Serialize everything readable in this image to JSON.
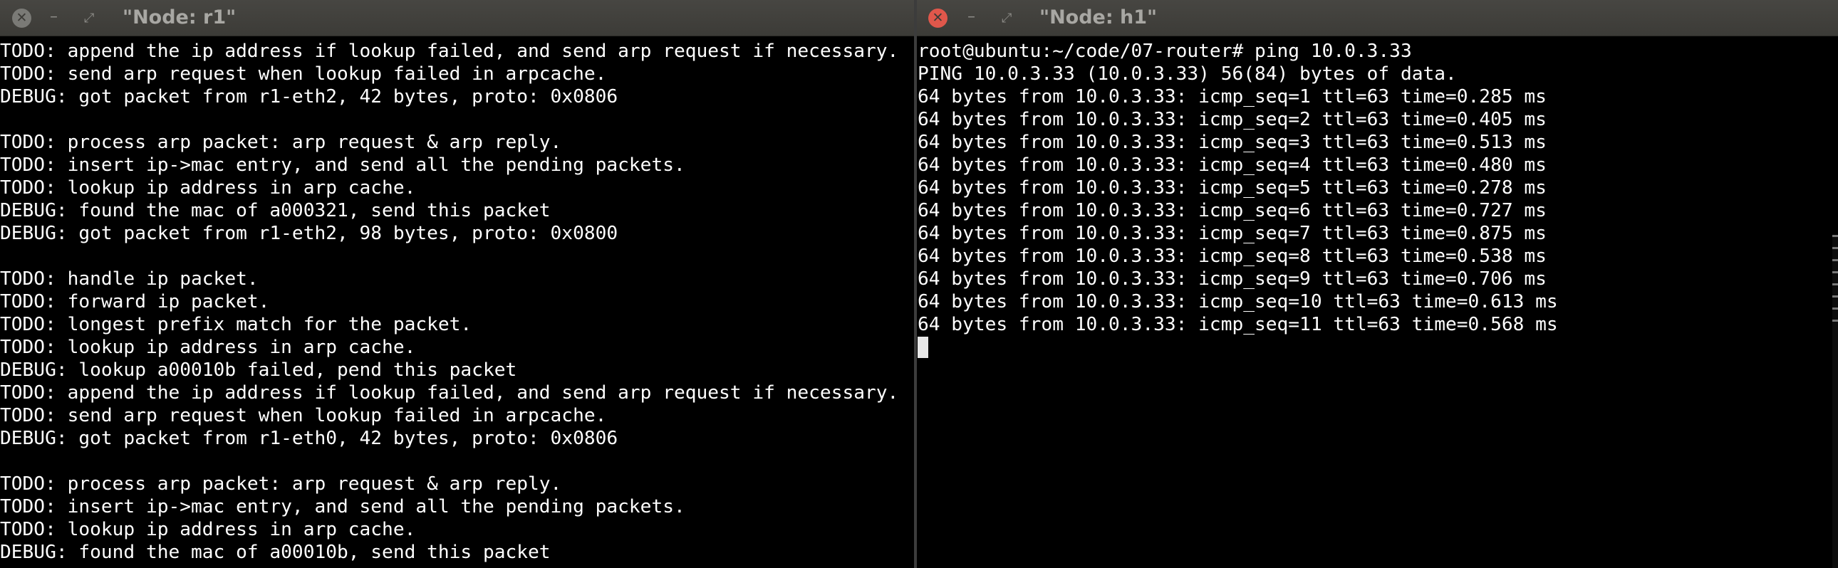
{
  "windows": {
    "r1": {
      "title": "\"Node: r1\"",
      "lines": [
        "TODO: append the ip address if lookup failed, and send arp request if necessary.",
        "TODO: send arp request when lookup failed in arpcache.",
        "DEBUG: got packet from r1-eth2, 42 bytes, proto: 0x0806",
        "",
        "TODO: process arp packet: arp request & arp reply.",
        "TODO: insert ip->mac entry, and send all the pending packets.",
        "TODO: lookup ip address in arp cache.",
        "DEBUG: found the mac of a000321, send this packet",
        "DEBUG: got packet from r1-eth2, 98 bytes, proto: 0x0800",
        "",
        "TODO: handle ip packet.",
        "TODO: forward ip packet.",
        "TODO: longest prefix match for the packet.",
        "TODO: lookup ip address in arp cache.",
        "DEBUG: lookup a00010b failed, pend this packet",
        "TODO: append the ip address if lookup failed, and send arp request if necessary.",
        "TODO: send arp request when lookup failed in arpcache.",
        "DEBUG: got packet from r1-eth0, 42 bytes, proto: 0x0806",
        "",
        "TODO: process arp packet: arp request & arp reply.",
        "TODO: insert ip->mac entry, and send all the pending packets.",
        "TODO: lookup ip address in arp cache.",
        "DEBUG: found the mac of a00010b, send this packet"
      ]
    },
    "h1": {
      "title": "\"Node: h1\"",
      "lines": [
        "root@ubuntu:~/code/07-router# ping 10.0.3.33",
        "PING 10.0.3.33 (10.0.3.33) 56(84) bytes of data.",
        "64 bytes from 10.0.3.33: icmp_seq=1 ttl=63 time=0.285 ms",
        "64 bytes from 10.0.3.33: icmp_seq=2 ttl=63 time=0.405 ms",
        "64 bytes from 10.0.3.33: icmp_seq=3 ttl=63 time=0.513 ms",
        "64 bytes from 10.0.3.33: icmp_seq=4 ttl=63 time=0.480 ms",
        "64 bytes from 10.0.3.33: icmp_seq=5 ttl=63 time=0.278 ms",
        "64 bytes from 10.0.3.33: icmp_seq=6 ttl=63 time=0.727 ms",
        "64 bytes from 10.0.3.33: icmp_seq=7 ttl=63 time=0.875 ms",
        "64 bytes from 10.0.3.33: icmp_seq=8 ttl=63 time=0.538 ms",
        "64 bytes from 10.0.3.33: icmp_seq=9 ttl=63 time=0.706 ms",
        "64 bytes from 10.0.3.33: icmp_seq=10 ttl=63 time=0.613 ms",
        "64 bytes from 10.0.3.33: icmp_seq=11 ttl=63 time=0.568 ms"
      ]
    }
  },
  "buttons": {
    "close": "✕",
    "minimize": "–",
    "maximize": "⤢"
  },
  "colors": {
    "terminal_bg": "#000000",
    "terminal_fg": "#ffffff",
    "titlebar_bg": "#3c3b37",
    "close_active": "#e0574b",
    "close_inactive": "#7a7a76"
  }
}
